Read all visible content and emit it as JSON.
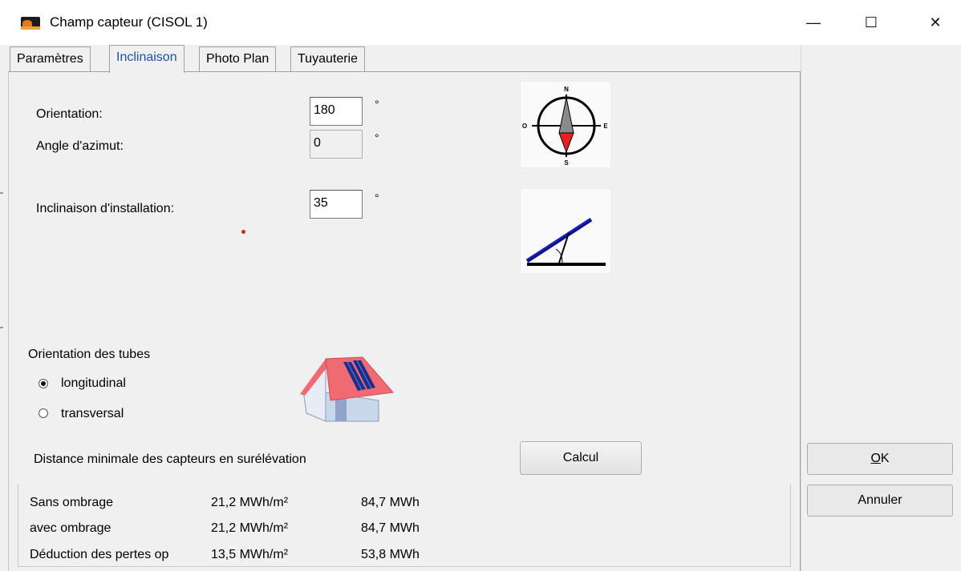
{
  "window": {
    "title": "Champ capteur  (CISOL 1)",
    "minimize_glyph": "—",
    "maximize_glyph": "☐",
    "close_glyph": "✕"
  },
  "tabs": [
    {
      "label": "Paramètres"
    },
    {
      "label": "Inclinaison"
    },
    {
      "label": "Photo Plan"
    },
    {
      "label": "Tuyauterie"
    }
  ],
  "inclinaison": {
    "orientation_label": "Orientation:",
    "orientation_value": "180",
    "azimut_label": "Angle d'azimut:",
    "azimut_value": "0",
    "install_label": "Inclinaison d'installation:",
    "install_value": "35",
    "degree_symbol": "°",
    "compass": {
      "north": "N",
      "south": "S",
      "east": "E",
      "west": "O"
    }
  },
  "tubes": {
    "group_label": "Orientation des tubes",
    "options": [
      {
        "label": "longitudinal",
        "checked": true
      },
      {
        "label": "transversal",
        "checked": false
      }
    ]
  },
  "distance": {
    "label": "Distance minimale des capteurs en surélévation",
    "calc_button": "Calcul"
  },
  "results": [
    {
      "label": "Sans ombrage",
      "per_m2": "21,2 MWh/m²",
      "total": "84,7 MWh"
    },
    {
      "label": "avec ombrage",
      "per_m2": "21,2 MWh/m²",
      "total": "84,7 MWh"
    },
    {
      "label": "Déduction des pertes op",
      "per_m2": "13,5 MWh/m²",
      "total": "53,8 MWh"
    }
  ],
  "dialog_buttons": {
    "ok": "OK",
    "ok_mnemonic": "O",
    "ok_rest": "K",
    "cancel": "Annuler"
  },
  "colors": {
    "active_tab": "#1e4fb8",
    "compass_arrow": "#e82020",
    "panel_line": "#2030c0",
    "roof": "#ef6a72"
  }
}
